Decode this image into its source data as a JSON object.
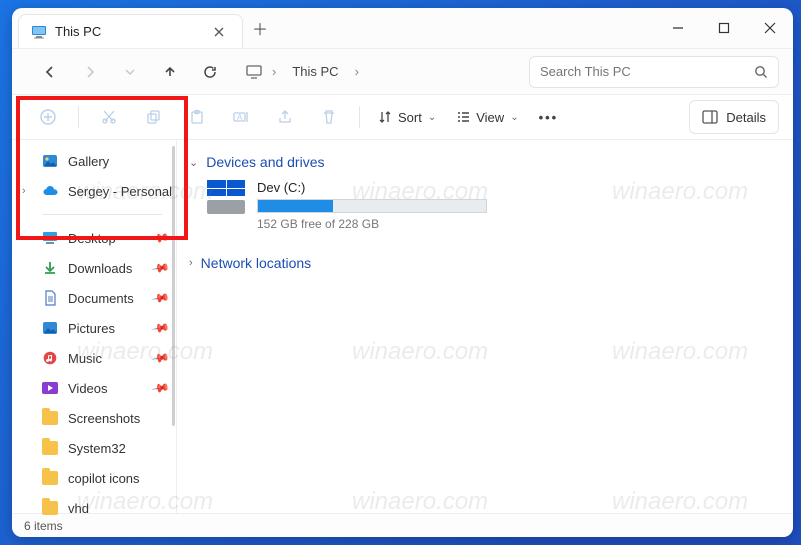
{
  "titlebar": {
    "tab_label": "This PC"
  },
  "breadcrumb": {
    "root_icon": "monitor",
    "current": "This PC"
  },
  "search": {
    "placeholder": "Search This PC"
  },
  "toolbar": {
    "sort_label": "Sort",
    "view_label": "View",
    "details_label": "Details"
  },
  "sidebar": {
    "top": [
      {
        "label": "Gallery",
        "icon": "gallery",
        "expandable": false
      },
      {
        "label": "Sergey - Personal",
        "icon": "onedrive",
        "expandable": true
      }
    ],
    "quick": [
      {
        "label": "Desktop",
        "icon": "desktop",
        "pinned": true
      },
      {
        "label": "Downloads",
        "icon": "downloads",
        "pinned": true
      },
      {
        "label": "Documents",
        "icon": "documents",
        "pinned": true
      },
      {
        "label": "Pictures",
        "icon": "pictures",
        "pinned": true
      },
      {
        "label": "Music",
        "icon": "music",
        "pinned": true
      },
      {
        "label": "Videos",
        "icon": "videos",
        "pinned": true
      },
      {
        "label": "Screenshots",
        "icon": "folder",
        "pinned": false
      },
      {
        "label": "System32",
        "icon": "folder",
        "pinned": false
      },
      {
        "label": "copilot icons",
        "icon": "folder",
        "pinned": false
      },
      {
        "label": "vhd",
        "icon": "folder",
        "pinned": false
      }
    ]
  },
  "content": {
    "sections": [
      {
        "title": "Devices and drives",
        "expanded": true
      },
      {
        "title": "Network locations",
        "expanded": false
      }
    ],
    "drive": {
      "name": "Dev (C:)",
      "free_text": "152 GB free of 228 GB",
      "fill_percent": 33
    }
  },
  "statusbar": {
    "text": "6 items"
  },
  "watermark": "winaero.com"
}
